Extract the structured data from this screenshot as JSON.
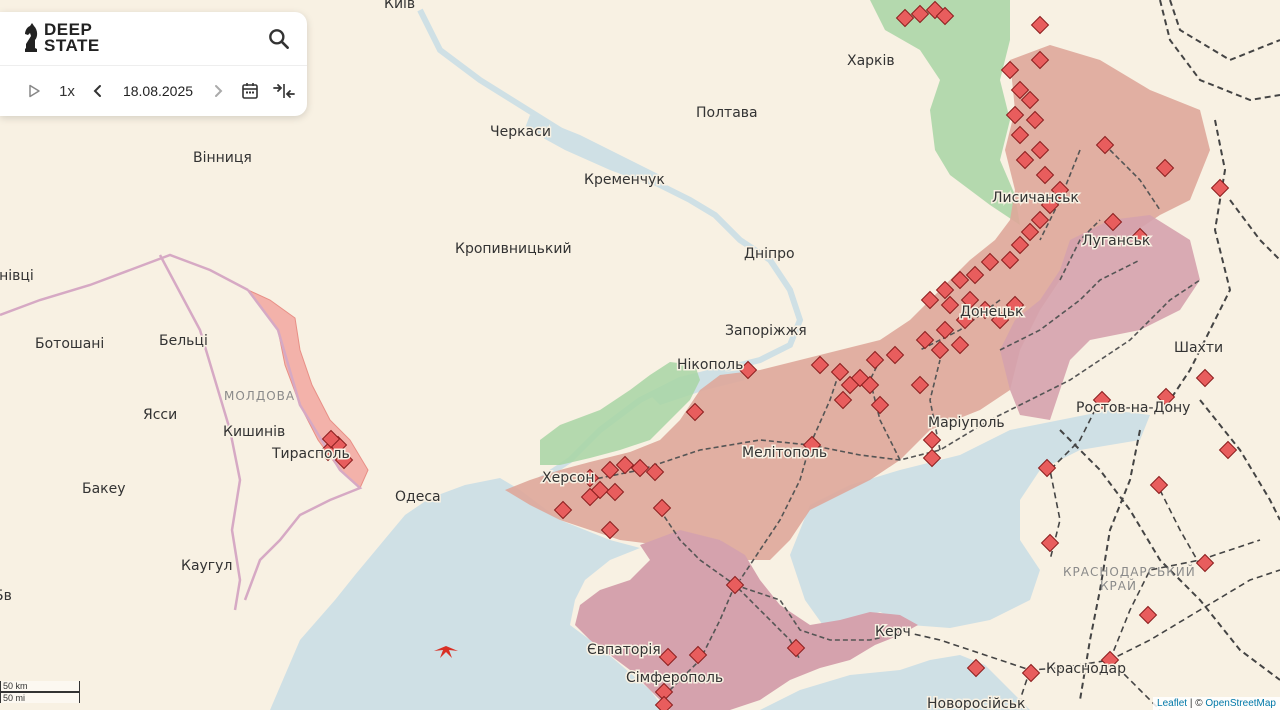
{
  "app": {
    "logo_line1": "DEEP",
    "logo_line2": "STATE",
    "speed": "1x",
    "date": "18.08.2025",
    "icons": [
      "search-icon",
      "play-icon",
      "chevron-left-icon",
      "chevron-right-icon",
      "calendar-icon",
      "collapse-arrows-icon"
    ]
  },
  "map": {
    "cities": [
      {
        "key": "kyiv",
        "name": "Київ"
      },
      {
        "key": "kharkiv",
        "name": "Харків"
      },
      {
        "key": "poltava",
        "name": "Полтава"
      },
      {
        "key": "cherkasy",
        "name": "Черкаси"
      },
      {
        "key": "vinnytsia",
        "name": "Вінниця"
      },
      {
        "key": "kremenchuk",
        "name": "Кременчук"
      },
      {
        "key": "kropyvnytskyi",
        "name": "Кропивницький"
      },
      {
        "key": "dnipro",
        "name": "Дніпро"
      },
      {
        "key": "lysychansk",
        "name": "Лисичанськ"
      },
      {
        "key": "luhansk",
        "name": "Луганськ"
      },
      {
        "key": "chernivtsi",
        "name": "Чернівці"
      },
      {
        "key": "botoshani",
        "name": "Ботошані"
      },
      {
        "key": "beltsi",
        "name": "Бельці"
      },
      {
        "key": "moldova",
        "name": "МОЛДОВА"
      },
      {
        "key": "iasi",
        "name": "Ясси"
      },
      {
        "key": "chisinau",
        "name": "Кишинів"
      },
      {
        "key": "tiraspol",
        "name": "Тирасполь"
      },
      {
        "key": "bacau",
        "name": "Бакеу"
      },
      {
        "key": "odesa",
        "name": "Одеса"
      },
      {
        "key": "kaugul",
        "name": "Каугул"
      },
      {
        "key": "zaporizhzhia",
        "name": "Запоріжжя"
      },
      {
        "key": "nikopol",
        "name": "Нікополь"
      },
      {
        "key": "donetsk",
        "name": "Донецьк"
      },
      {
        "key": "shakhty",
        "name": "Шахти"
      },
      {
        "key": "kherson",
        "name": "Херсон"
      },
      {
        "key": "melitopol",
        "name": "Мелітополь"
      },
      {
        "key": "mariupol",
        "name": "Маріуполь"
      },
      {
        "key": "rostov",
        "name": "Ростов-на-Дону"
      },
      {
        "key": "krasnodar_krai_1",
        "name": "КРАСНОДАРСЬКИЙ"
      },
      {
        "key": "krasnodar_krai_2",
        "name": "КРАЙ"
      },
      {
        "key": "kerch",
        "name": "Керч"
      },
      {
        "key": "yevpatoria",
        "name": "Євпаторія"
      },
      {
        "key": "simferopol",
        "name": "Сімферополь"
      },
      {
        "key": "krasnodar",
        "name": "Краснодар"
      },
      {
        "key": "novorossiysk",
        "name": "Новоросійськ"
      },
      {
        "key": "bv",
        "name": "Бв"
      }
    ],
    "colors": {
      "land": "#f8f1e3",
      "water": "#cfe0e5",
      "occupied": "#dea79a",
      "occupied_before_2022": "#d5a2ad",
      "liberated": "#a8d5a5",
      "transnistria": "#f3b2aa",
      "frontline_marker": "#e85d5d"
    },
    "scale": {
      "metric": "50 km",
      "imperial": "50 mi"
    },
    "attribution_leaflet": "Leaflet",
    "attribution_sep": " | © ",
    "attribution_osm": "OpenStreetMap"
  }
}
